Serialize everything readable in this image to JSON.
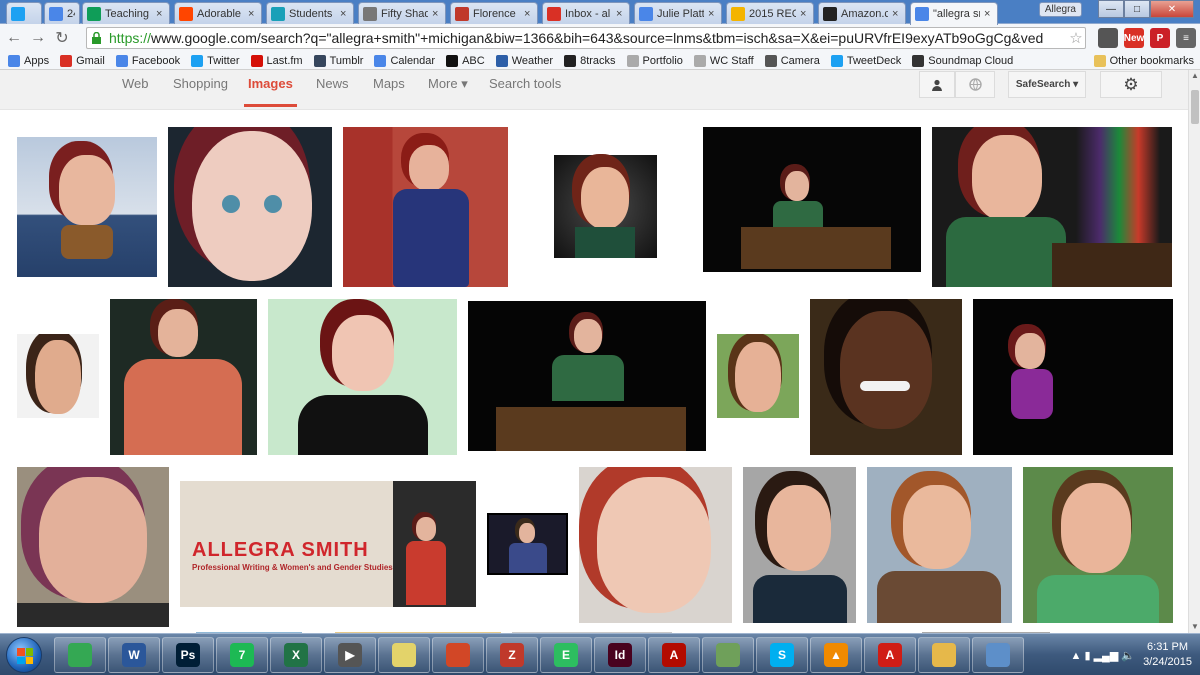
{
  "browser": {
    "tabs": [
      {
        "title": "",
        "favicon": "twitter-icon",
        "color": "#1da1f2"
      },
      {
        "title": "24",
        "favicon": "calendar-icon",
        "color": "#4a86e8"
      },
      {
        "title": "Teaching",
        "favicon": "sheets-icon",
        "color": "#0f9d58"
      },
      {
        "title": "Adorable",
        "favicon": "reddit-icon",
        "color": "#ff4500"
      },
      {
        "title": "Students",
        "favicon": "doc-icon",
        "color": "#19a0b8"
      },
      {
        "title": "Fifty Shad",
        "favicon": "h-icon",
        "color": "#777777"
      },
      {
        "title": "Florence",
        "favicon": "sm-icon",
        "color": "#c0392b"
      },
      {
        "title": "Inbox - al",
        "favicon": "gmail-icon",
        "color": "#d93025"
      },
      {
        "title": "Julie Platt",
        "favicon": "google-icon",
        "color": "#4a86e8"
      },
      {
        "title": "2015 REC",
        "favicon": "drive-icon",
        "color": "#f4b400"
      },
      {
        "title": "Amazon.c",
        "favicon": "amazon-icon",
        "color": "#222222"
      },
      {
        "title": "\"allegra sr",
        "favicon": "google-icon",
        "color": "#4a86e8"
      }
    ],
    "close_glyph": "×",
    "user_badge": "Allegra",
    "window_controls": {
      "minimize": "—",
      "maximize": "□",
      "close": "✕"
    },
    "nav": {
      "back": "←",
      "forward": "→",
      "reload": "↻"
    },
    "url_scheme": "https://",
    "url_rest": "www.google.com/search?q=\"allegra+smith\"+michigan&biw=1366&bih=643&source=lnms&tbm=isch&sa=X&ei=puURVfrEI9exyATb9oGgCg&ved",
    "star": "☆",
    "extensions": [
      {
        "name": "extension-icon",
        "label": "",
        "color": "#555555"
      },
      {
        "name": "new-badge-icon",
        "label": "New",
        "color": "#d93025"
      },
      {
        "name": "pinterest-icon",
        "label": "P",
        "color": "#cb2027"
      },
      {
        "name": "menu-icon",
        "label": "≡",
        "color": "#666666"
      }
    ]
  },
  "bookmarks": {
    "items": [
      {
        "label": "Apps",
        "icon": "apps-icon",
        "color": "#4a86e8"
      },
      {
        "label": "Gmail",
        "icon": "gmail-icon",
        "color": "#d93025"
      },
      {
        "label": "Facebook",
        "icon": "google-icon",
        "color": "#4a86e8"
      },
      {
        "label": "Twitter",
        "icon": "twitter-icon",
        "color": "#1da1f2"
      },
      {
        "label": "Last.fm",
        "icon": "lastfm-icon",
        "color": "#d51007"
      },
      {
        "label": "Tumblr",
        "icon": "tumblr-icon",
        "color": "#36465d"
      },
      {
        "label": "Calendar",
        "icon": "calendar-icon",
        "color": "#4a86e8"
      },
      {
        "label": "ABC",
        "icon": "abc-icon",
        "color": "#111111"
      },
      {
        "label": "Weather",
        "icon": "weather-icon",
        "color": "#2d5fa8"
      },
      {
        "label": "8tracks",
        "icon": "8tracks-icon",
        "color": "#222222"
      },
      {
        "label": "Portfolio",
        "icon": "page-icon",
        "color": "#aaaaaa"
      },
      {
        "label": "WC Staff",
        "icon": "page-icon",
        "color": "#aaaaaa"
      },
      {
        "label": "Camera",
        "icon": "camera-icon",
        "color": "#555555"
      },
      {
        "label": "TweetDeck",
        "icon": "tweetdeck-icon",
        "color": "#1da1f2"
      },
      {
        "label": "Soundmap Cloud",
        "icon": "soundcloud-icon",
        "color": "#333333"
      }
    ],
    "other": "Other bookmarks"
  },
  "google_nav": {
    "tabs": [
      "Web",
      "Shopping",
      "Images",
      "News",
      "Maps",
      "More ▾",
      "Search tools"
    ],
    "active": "Images",
    "safesearch": "SafeSearch ▾",
    "settings_glyph": "⚙"
  },
  "results": {
    "banner_title": "ALLEGRA SMITH",
    "banner_subtitle": "Professional Writing & Women's and Gender Studies"
  },
  "scrollbar": {
    "up": "▲",
    "down": "▼"
  },
  "taskbar": {
    "apps": [
      {
        "name": "chrome-icon",
        "label": "",
        "color": "#34a853"
      },
      {
        "name": "word-icon",
        "label": "W",
        "color": "#2b579a"
      },
      {
        "name": "photoshop-icon",
        "label": "Ps",
        "color": "#001e36"
      },
      {
        "name": "spotify-icon",
        "label": "7",
        "color": "#1db954"
      },
      {
        "name": "excel-icon",
        "label": "X",
        "color": "#217346"
      },
      {
        "name": "movie-icon",
        "label": "▶",
        "color": "#555555"
      },
      {
        "name": "stickynotes-icon",
        "label": "",
        "color": "#e3d36a"
      },
      {
        "name": "office-icon",
        "label": "",
        "color": "#d24726"
      },
      {
        "name": "app-icon",
        "label": "Z",
        "color": "#c0392b"
      },
      {
        "name": "evernote-icon",
        "label": "E",
        "color": "#2dbe60"
      },
      {
        "name": "indesign-icon",
        "label": "Id",
        "color": "#49021f"
      },
      {
        "name": "acrobat-icon",
        "label": "A",
        "color": "#b30b00"
      },
      {
        "name": "notes-icon",
        "label": "",
        "color": "#6fa05a"
      },
      {
        "name": "skype-icon",
        "label": "S",
        "color": "#00aff0"
      },
      {
        "name": "vlc-icon",
        "label": "▲",
        "color": "#f08a00"
      },
      {
        "name": "acrobat-reader-icon",
        "label": "A",
        "color": "#d01d15"
      },
      {
        "name": "explorer-icon",
        "label": "",
        "color": "#e6b84a"
      },
      {
        "name": "screen-icon",
        "label": "",
        "color": "#5d8fc9"
      }
    ],
    "tray_glyphs": "▲ ▮ ▂▄▆ 🔈",
    "time": "6:31 PM",
    "date": "3/24/2015"
  }
}
